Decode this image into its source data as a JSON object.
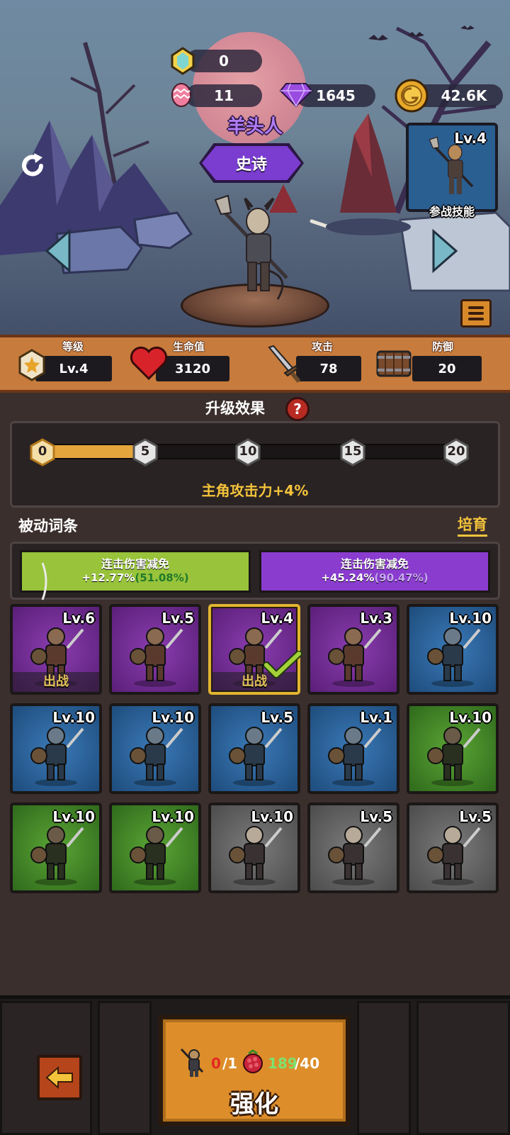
{
  "resources": {
    "crystal": "0",
    "eggs": "11",
    "gems": "1645",
    "gold": "42.6K"
  },
  "hero": {
    "name": "羊头人",
    "rarity": "史诗"
  },
  "skill_card": {
    "level": "Lv.4",
    "label": "参战技能"
  },
  "stats": {
    "level": {
      "title": "等级",
      "value": "Lv.4"
    },
    "hp": {
      "title": "生命值",
      "value": "3120"
    },
    "attack": {
      "title": "攻击",
      "value": "78"
    },
    "defense": {
      "title": "防御",
      "value": "20"
    }
  },
  "upgrade_effect": {
    "title": "升级效果",
    "help": "?",
    "nodes": [
      "0",
      "5",
      "10",
      "15",
      "20"
    ],
    "progress_fraction": 0.23,
    "effect_text": "主角攻击力+4%"
  },
  "passive": {
    "title": "被动词条",
    "cultivate": "培育",
    "items": [
      {
        "name": "连击伤害减免",
        "value": "+12.77%",
        "total": "(51.08%)",
        "color": "#98c33a"
      },
      {
        "name": "连击伤害减免",
        "value": "+45.24%",
        "total": "(90.47%)",
        "color": "#8a3ccf"
      }
    ]
  },
  "heroes": [
    {
      "level": "Lv.6",
      "color": "purple",
      "deploy": "出战",
      "icon": "worm-icon"
    },
    {
      "level": "Lv.5",
      "color": "purple",
      "icon": "bat-icon"
    },
    {
      "level": "Lv.4",
      "color": "purple",
      "deploy": "出战",
      "selected": true,
      "icon": "goat-warrior-icon"
    },
    {
      "level": "Lv.3",
      "color": "purple",
      "icon": "spider-icon"
    },
    {
      "level": "Lv.10",
      "color": "blue",
      "icon": "orc-warrior-icon"
    },
    {
      "level": "Lv.10",
      "color": "blue",
      "icon": "bat-demon-icon"
    },
    {
      "level": "Lv.10",
      "color": "blue",
      "icon": "beetle-icon"
    },
    {
      "level": "Lv.5",
      "color": "blue",
      "icon": "minotaur-icon"
    },
    {
      "level": "Lv.1",
      "color": "blue",
      "icon": "skeleton-warrior-icon"
    },
    {
      "level": "Lv.10",
      "color": "green",
      "icon": "purple-spider-icon"
    },
    {
      "level": "Lv.10",
      "color": "green",
      "icon": "goat-warrior-icon"
    },
    {
      "level": "Lv.10",
      "color": "green",
      "icon": "shaman-icon"
    },
    {
      "level": "Lv.10",
      "color": "gray",
      "icon": "shaman-icon"
    },
    {
      "level": "Lv.5",
      "color": "gray",
      "icon": "skeleton-warrior-icon"
    },
    {
      "level": "Lv.5",
      "color": "gray",
      "icon": "imp-warrior-icon"
    }
  ],
  "upgrade": {
    "shard_have": "0",
    "shard_need": "/1",
    "berry_have": "189",
    "berry_need": "/40",
    "label": "强化"
  }
}
